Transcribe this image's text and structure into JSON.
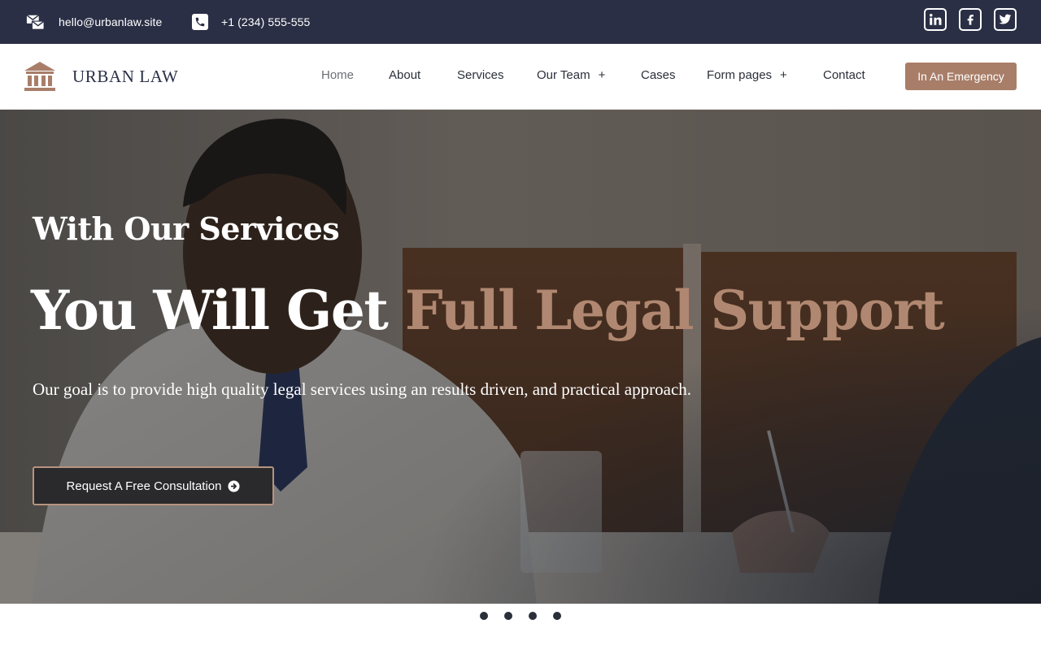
{
  "topbar": {
    "email": "hello@urbanlaw.site",
    "phone": "+1 (234) 555-555",
    "email_icon": "envelopes-icon",
    "phone_icon": "phone-icon",
    "social": [
      {
        "name": "linkedin",
        "icon": "linkedin-icon"
      },
      {
        "name": "facebook",
        "icon": "facebook-icon"
      },
      {
        "name": "twitter",
        "icon": "twitter-icon"
      }
    ]
  },
  "brand": {
    "name": "URBAN LAW",
    "logo_icon": "courthouse-icon"
  },
  "nav": {
    "items": [
      {
        "label": "Home",
        "active": true
      },
      {
        "label": "About"
      },
      {
        "label": "Services"
      },
      {
        "label": "Our Team",
        "submenu": "+"
      },
      {
        "label": "Cases"
      },
      {
        "label": "Form pages",
        "submenu": "+"
      },
      {
        "label": "Contact"
      }
    ],
    "emergency_label": "In An Emergency"
  },
  "hero": {
    "eyebrow": "With Our Services",
    "title_lead": "You Will Get ",
    "title_accent": "Full Legal Support",
    "subtitle": "Our goal is to provide high quality legal services using an results driven, and practical approach.",
    "cta_label": "Request A Free Consultation",
    "cta_icon": "arrow-circle-right-icon"
  },
  "slider": {
    "dot_count": 4
  },
  "colors": {
    "topbar": "#2a2f45",
    "accent": "#a87e69",
    "accent_text": "#b08770",
    "cta_bg": "#2a2a2c"
  }
}
